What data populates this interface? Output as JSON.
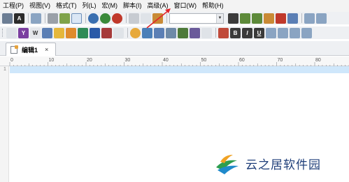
{
  "menubar": {
    "items": [
      {
        "label": "工程(P)"
      },
      {
        "label": "视图(V)"
      },
      {
        "label": "格式(T)"
      },
      {
        "label": "列(L)"
      },
      {
        "label": "宏(M)"
      },
      {
        "label": "脚本(I)"
      },
      {
        "label": "高级(A)"
      },
      {
        "label": "窗口(W)"
      },
      {
        "label": "帮助(H)"
      }
    ]
  },
  "toolbar": {
    "combo_value": "",
    "format_buttons": {
      "bold": "B",
      "italic": "I",
      "underline": "U"
    }
  },
  "tabs": [
    {
      "label": "编辑1",
      "close": "×"
    }
  ],
  "ruler": {
    "labels": [
      "0",
      "10",
      "20",
      "30",
      "40",
      "50",
      "60",
      "70",
      "80",
      "90"
    ]
  },
  "editor": {
    "line_numbers": [
      "1"
    ]
  },
  "watermark": {
    "text": "云之居软件园"
  },
  "colors": {
    "annotation_arrow": "#e0252b",
    "current_line": "#cfe7fb"
  }
}
